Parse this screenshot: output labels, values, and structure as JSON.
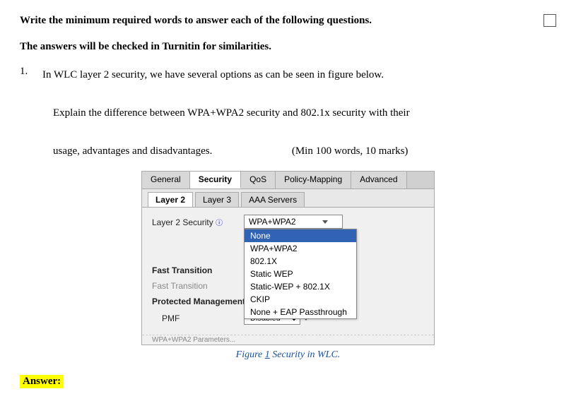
{
  "header": {
    "instruction": "Write the minimum required words to answer each of the following questions.",
    "warning": "The answers will be checked in Turnitin for similarities."
  },
  "question": {
    "number": "1.",
    "lines": [
      "In WLC layer 2 security, we have several options as can be seen in figure below.",
      "Explain the difference between WPA+WPA2 security and 802.1x security with their",
      "usage, advantages and disadvantages."
    ],
    "marks": "(Min 100 words, 10 marks)"
  },
  "wlc": {
    "tabs_top": [
      "General",
      "Security",
      "QoS",
      "Policy-Mapping",
      "Advanced"
    ],
    "active_top": "Security",
    "tabs_second": [
      "Layer 2",
      "Layer 3",
      "AAA Servers"
    ],
    "active_second": "Layer 2",
    "field_label": "Layer 2 Security",
    "field_info_icon": "ⓘ",
    "selected_value": "WPA+WPA2",
    "dropdown_items": [
      "None",
      "WPA+WPA2",
      "802.1X",
      "Static WEP",
      "Static-WEP + 802.1X",
      "CKIP",
      "None + EAP Passthrough"
    ],
    "dropdown_highlighted": "None",
    "fast_transition_label": "Fast Transition",
    "fast_transition_checkbox_label": "Fast Transition",
    "protected_mgmt_label": "Protected Management",
    "pmf_label": "PMF",
    "pmf_value": "Disabled",
    "bottom_cut_text": "WPA+WPA2 Parameters..."
  },
  "figure": {
    "caption_prefix": "Figure ",
    "figure_number": "1",
    "caption_suffix": " Security in WLC."
  },
  "answer": {
    "label": "Answer:"
  }
}
